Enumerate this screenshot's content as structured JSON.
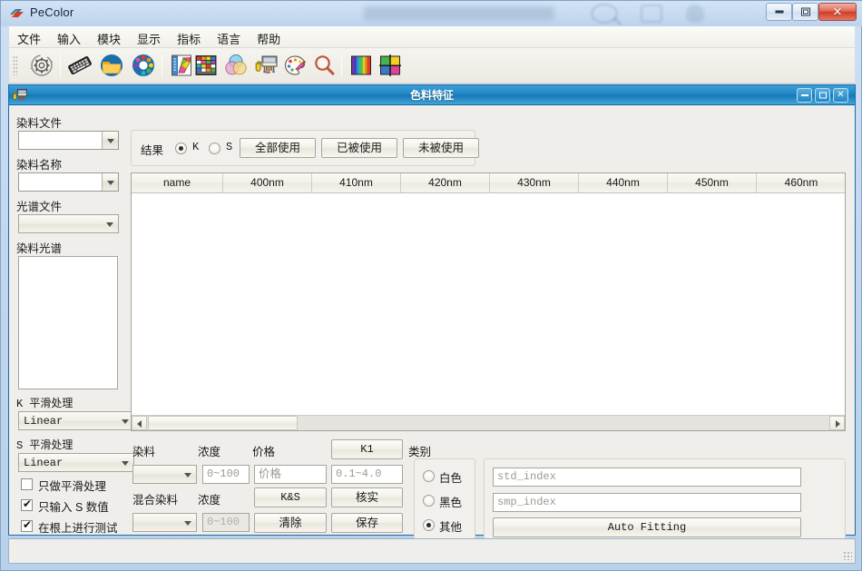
{
  "window": {
    "title": "PeColor",
    "app_icon": "pecolor-logo-icon",
    "buttons": {
      "minimize": "–",
      "maximize": "□",
      "close": "✕"
    }
  },
  "menubar": {
    "items": [
      {
        "label": "文件",
        "name": "menu-file"
      },
      {
        "label": "输入",
        "name": "menu-input"
      },
      {
        "label": "模块",
        "name": "menu-module"
      },
      {
        "label": "显示",
        "name": "menu-display"
      },
      {
        "label": "指标",
        "name": "menu-index"
      },
      {
        "label": "语言",
        "name": "menu-language"
      },
      {
        "label": "帮助",
        "name": "menu-help"
      }
    ]
  },
  "toolbar": {
    "icons": [
      "settings-gear-icon",
      "keyboard-icon",
      "open-folder-icon",
      "color-wheel-icon",
      "color-swatch-ruler-icon",
      "color-chart-grid-icon",
      "venn-color-mix-icon",
      "lab-flask-icon",
      "paint-palette-icon",
      "magnifier-search-icon",
      "spectrum-bars-icon",
      "color-quadrant-icon"
    ]
  },
  "dialog": {
    "title": "色料特征",
    "icon": "lab-flask-icon",
    "buttons": {
      "minimize": "–",
      "maximize": "□",
      "close": "✕"
    }
  },
  "left_panel": {
    "dye_file_label": "染料文件",
    "dye_file_value": "",
    "dye_name_label": "染料名称",
    "dye_name_value": "",
    "spectrum_file_label": "光谱文件",
    "spectrum_file_value": "",
    "dye_spectrum_label": "染料光谱",
    "k_smooth_label": "K 平滑处理",
    "k_smooth_value": "Linear",
    "s_smooth_label": "S 平滑处理",
    "s_smooth_value": "Linear",
    "checkboxes": [
      {
        "label": "只做平滑处理",
        "checked": false,
        "name": "checkbox-smooth-only"
      },
      {
        "label": "只输入 S 数值",
        "checked": true,
        "name": "checkbox-s-value-only"
      },
      {
        "label": "在根上进行测试",
        "checked": true,
        "name": "checkbox-test-on-root"
      }
    ]
  },
  "result_bar": {
    "label": "结果",
    "radios": [
      {
        "label": "K",
        "checked": true,
        "name": "radio-result-k"
      },
      {
        "label": "S",
        "checked": false,
        "name": "radio-result-s"
      }
    ],
    "buttons": [
      {
        "label": "全部使用",
        "name": "button-use-all"
      },
      {
        "label": "已被使用",
        "name": "button-used"
      },
      {
        "label": "未被使用",
        "name": "button-unused"
      }
    ]
  },
  "table": {
    "columns": [
      "name",
      "400nm",
      "410nm",
      "420nm",
      "430nm",
      "440nm",
      "450nm",
      "460nm"
    ],
    "rows": []
  },
  "dye_panel": {
    "dye_label": "染料",
    "dye_value": "",
    "concentration_label": "浓度",
    "concentration_placeholder": "0~100",
    "price_label": "价格",
    "price_placeholder": "价格",
    "k1_button": "K1",
    "k1_range_placeholder": "0.1~4.0",
    "mixed_dye_label": "混合染料",
    "mixed_dye_value": "",
    "mixed_concentration_label": "浓度",
    "mixed_concentration_placeholder": "0~100",
    "ks_button": "K&S",
    "verify_button": "核实",
    "clear_button": "清除",
    "save_button": "保存"
  },
  "category_panel": {
    "title": "类别",
    "radios": [
      {
        "label": "白色",
        "checked": false,
        "name": "radio-category-white"
      },
      {
        "label": "黑色",
        "checked": false,
        "name": "radio-category-black"
      },
      {
        "label": "其他",
        "checked": true,
        "name": "radio-category-other"
      }
    ],
    "std_index_placeholder": "std_index",
    "std_index_value": "",
    "smp_index_placeholder": "smp_index",
    "smp_index_value": "",
    "auto_fitting_button": "Auto Fitting"
  },
  "colors": {
    "titlebar_accent": "#1f86c6",
    "window_chrome": "#c3d7ee",
    "panel_bg": "#efeeea",
    "close_button": "#cf3d27"
  }
}
